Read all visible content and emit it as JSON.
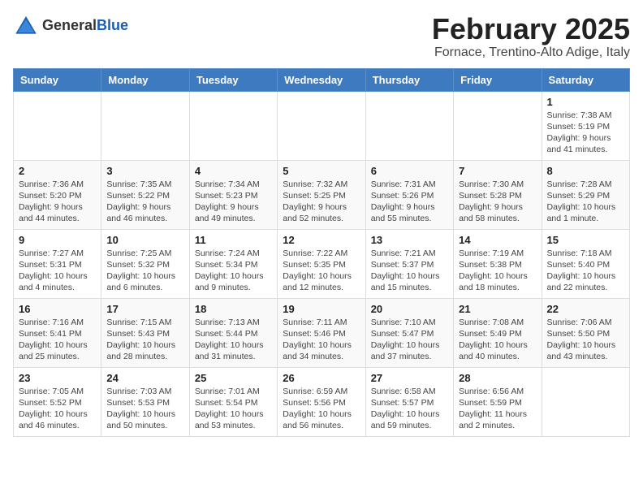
{
  "logo": {
    "general": "General",
    "blue": "Blue"
  },
  "header": {
    "title": "February 2025",
    "subtitle": "Fornace, Trentino-Alto Adige, Italy"
  },
  "weekdays": [
    "Sunday",
    "Monday",
    "Tuesday",
    "Wednesday",
    "Thursday",
    "Friday",
    "Saturday"
  ],
  "weeks": [
    [
      {
        "day": "",
        "info": ""
      },
      {
        "day": "",
        "info": ""
      },
      {
        "day": "",
        "info": ""
      },
      {
        "day": "",
        "info": ""
      },
      {
        "day": "",
        "info": ""
      },
      {
        "day": "",
        "info": ""
      },
      {
        "day": "1",
        "info": "Sunrise: 7:38 AM\nSunset: 5:19 PM\nDaylight: 9 hours and 41 minutes."
      }
    ],
    [
      {
        "day": "2",
        "info": "Sunrise: 7:36 AM\nSunset: 5:20 PM\nDaylight: 9 hours and 44 minutes."
      },
      {
        "day": "3",
        "info": "Sunrise: 7:35 AM\nSunset: 5:22 PM\nDaylight: 9 hours and 46 minutes."
      },
      {
        "day": "4",
        "info": "Sunrise: 7:34 AM\nSunset: 5:23 PM\nDaylight: 9 hours and 49 minutes."
      },
      {
        "day": "5",
        "info": "Sunrise: 7:32 AM\nSunset: 5:25 PM\nDaylight: 9 hours and 52 minutes."
      },
      {
        "day": "6",
        "info": "Sunrise: 7:31 AM\nSunset: 5:26 PM\nDaylight: 9 hours and 55 minutes."
      },
      {
        "day": "7",
        "info": "Sunrise: 7:30 AM\nSunset: 5:28 PM\nDaylight: 9 hours and 58 minutes."
      },
      {
        "day": "8",
        "info": "Sunrise: 7:28 AM\nSunset: 5:29 PM\nDaylight: 10 hours and 1 minute."
      }
    ],
    [
      {
        "day": "9",
        "info": "Sunrise: 7:27 AM\nSunset: 5:31 PM\nDaylight: 10 hours and 4 minutes."
      },
      {
        "day": "10",
        "info": "Sunrise: 7:25 AM\nSunset: 5:32 PM\nDaylight: 10 hours and 6 minutes."
      },
      {
        "day": "11",
        "info": "Sunrise: 7:24 AM\nSunset: 5:34 PM\nDaylight: 10 hours and 9 minutes."
      },
      {
        "day": "12",
        "info": "Sunrise: 7:22 AM\nSunset: 5:35 PM\nDaylight: 10 hours and 12 minutes."
      },
      {
        "day": "13",
        "info": "Sunrise: 7:21 AM\nSunset: 5:37 PM\nDaylight: 10 hours and 15 minutes."
      },
      {
        "day": "14",
        "info": "Sunrise: 7:19 AM\nSunset: 5:38 PM\nDaylight: 10 hours and 18 minutes."
      },
      {
        "day": "15",
        "info": "Sunrise: 7:18 AM\nSunset: 5:40 PM\nDaylight: 10 hours and 22 minutes."
      }
    ],
    [
      {
        "day": "16",
        "info": "Sunrise: 7:16 AM\nSunset: 5:41 PM\nDaylight: 10 hours and 25 minutes."
      },
      {
        "day": "17",
        "info": "Sunrise: 7:15 AM\nSunset: 5:43 PM\nDaylight: 10 hours and 28 minutes."
      },
      {
        "day": "18",
        "info": "Sunrise: 7:13 AM\nSunset: 5:44 PM\nDaylight: 10 hours and 31 minutes."
      },
      {
        "day": "19",
        "info": "Sunrise: 7:11 AM\nSunset: 5:46 PM\nDaylight: 10 hours and 34 minutes."
      },
      {
        "day": "20",
        "info": "Sunrise: 7:10 AM\nSunset: 5:47 PM\nDaylight: 10 hours and 37 minutes."
      },
      {
        "day": "21",
        "info": "Sunrise: 7:08 AM\nSunset: 5:49 PM\nDaylight: 10 hours and 40 minutes."
      },
      {
        "day": "22",
        "info": "Sunrise: 7:06 AM\nSunset: 5:50 PM\nDaylight: 10 hours and 43 minutes."
      }
    ],
    [
      {
        "day": "23",
        "info": "Sunrise: 7:05 AM\nSunset: 5:52 PM\nDaylight: 10 hours and 46 minutes."
      },
      {
        "day": "24",
        "info": "Sunrise: 7:03 AM\nSunset: 5:53 PM\nDaylight: 10 hours and 50 minutes."
      },
      {
        "day": "25",
        "info": "Sunrise: 7:01 AM\nSunset: 5:54 PM\nDaylight: 10 hours and 53 minutes."
      },
      {
        "day": "26",
        "info": "Sunrise: 6:59 AM\nSunset: 5:56 PM\nDaylight: 10 hours and 56 minutes."
      },
      {
        "day": "27",
        "info": "Sunrise: 6:58 AM\nSunset: 5:57 PM\nDaylight: 10 hours and 59 minutes."
      },
      {
        "day": "28",
        "info": "Sunrise: 6:56 AM\nSunset: 5:59 PM\nDaylight: 11 hours and 2 minutes."
      },
      {
        "day": "",
        "info": ""
      }
    ]
  ]
}
